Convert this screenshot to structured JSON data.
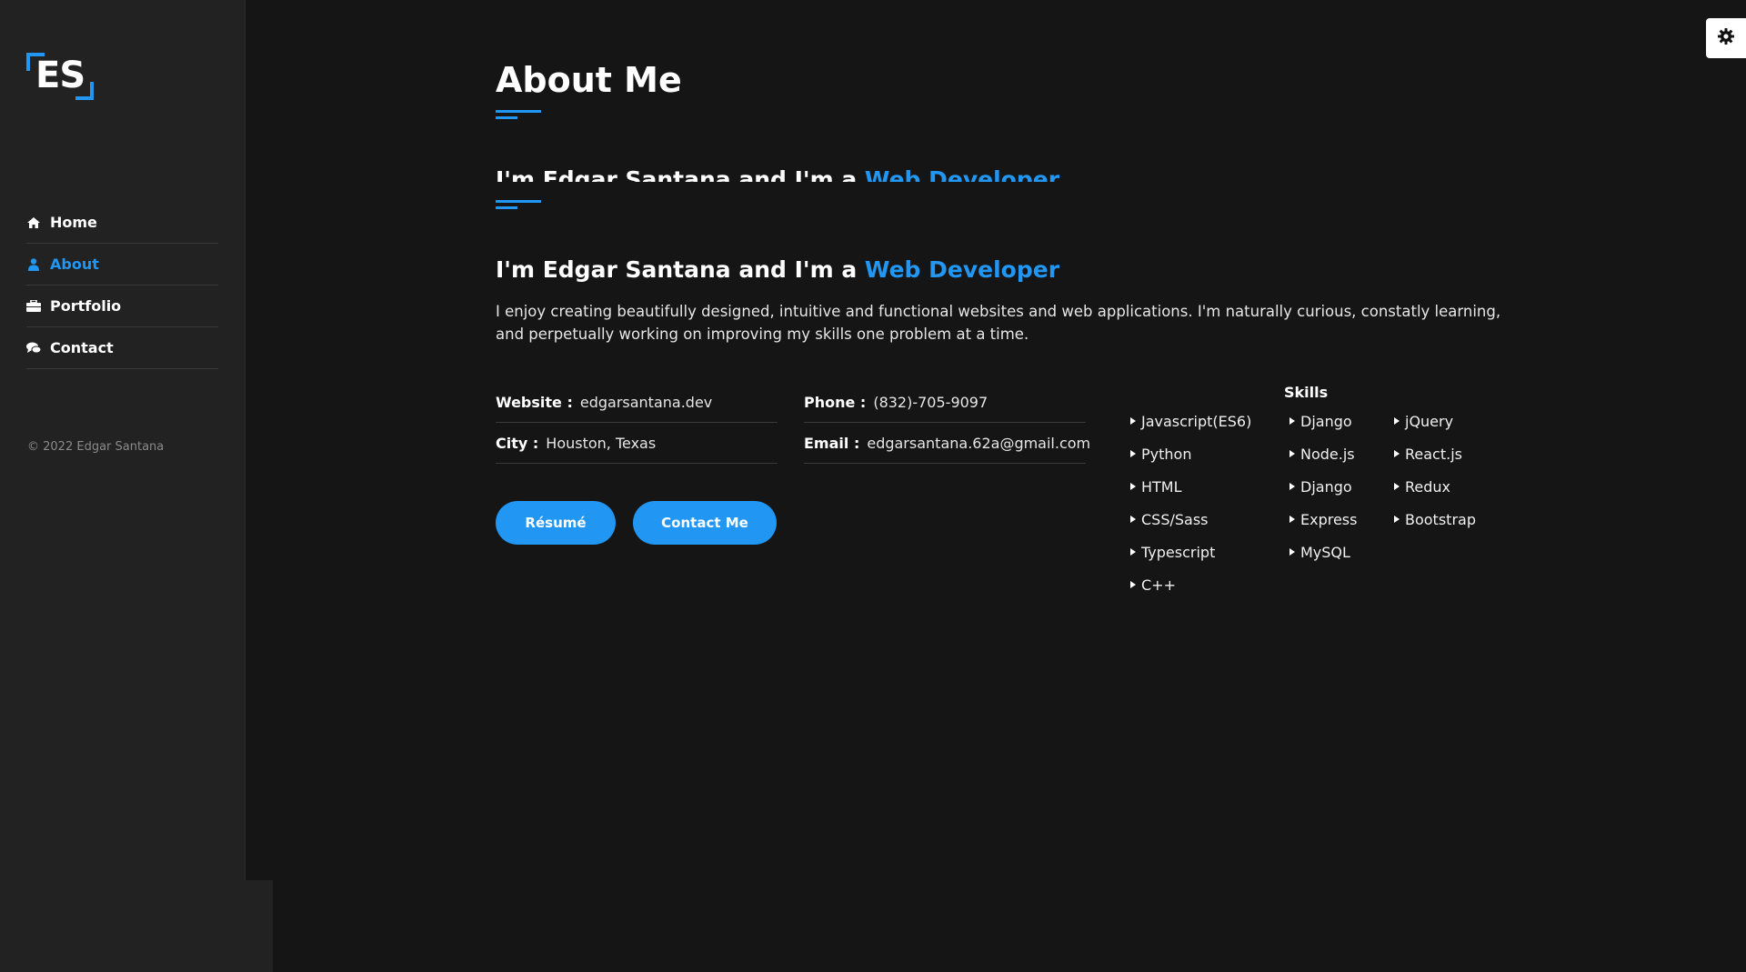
{
  "sidebar": {
    "logo": "ES",
    "nav": [
      {
        "label": "Home",
        "icon": "home-icon"
      },
      {
        "label": "About",
        "icon": "user-icon"
      },
      {
        "label": "Portfolio",
        "icon": "briefcase-icon"
      },
      {
        "label": "Contact",
        "icon": "comments-icon"
      }
    ],
    "copyright": "© 2022 Edgar Santana"
  },
  "settings": {
    "icon": "gear-icon"
  },
  "about": {
    "title": "About Me",
    "typing_line": {
      "prefix": "I'm Edgar Santana and I'm a ",
      "role": "Web Developer"
    },
    "headline": {
      "prefix": "I'm Edgar Santana and I'm a ",
      "role": "Web Developer"
    },
    "bio": "I enjoy creating beautifully designed, intuitive and functional websites and web applications. I'm naturally curious, constatly learning, and perpetually working on improving my skills one problem at a time.",
    "info": {
      "website": {
        "label": "Website :",
        "value": "edgarsantana.dev"
      },
      "city": {
        "label": "City :",
        "value": "Houston, Texas"
      },
      "phone": {
        "label": "Phone :",
        "value": "(832)-705-9097"
      },
      "email": {
        "label": "Email :",
        "value": "edgarsantana.62a@gmail.com"
      }
    },
    "buttons": {
      "resume": "Résumé",
      "contact": "Contact Me"
    }
  },
  "skills": {
    "title": "Skills",
    "columns": [
      [
        "Javascript(ES6)",
        "Python",
        "HTML",
        "CSS/Sass",
        "Typescript",
        "C++"
      ],
      [
        "Django",
        "Node.js",
        "Django",
        "Express",
        "MySQL"
      ],
      [
        "jQuery",
        "React.js",
        "Redux",
        "Bootstrap"
      ]
    ]
  },
  "colors": {
    "accent": "#2196f3",
    "background": "#151515",
    "sidebar": "#222222"
  }
}
